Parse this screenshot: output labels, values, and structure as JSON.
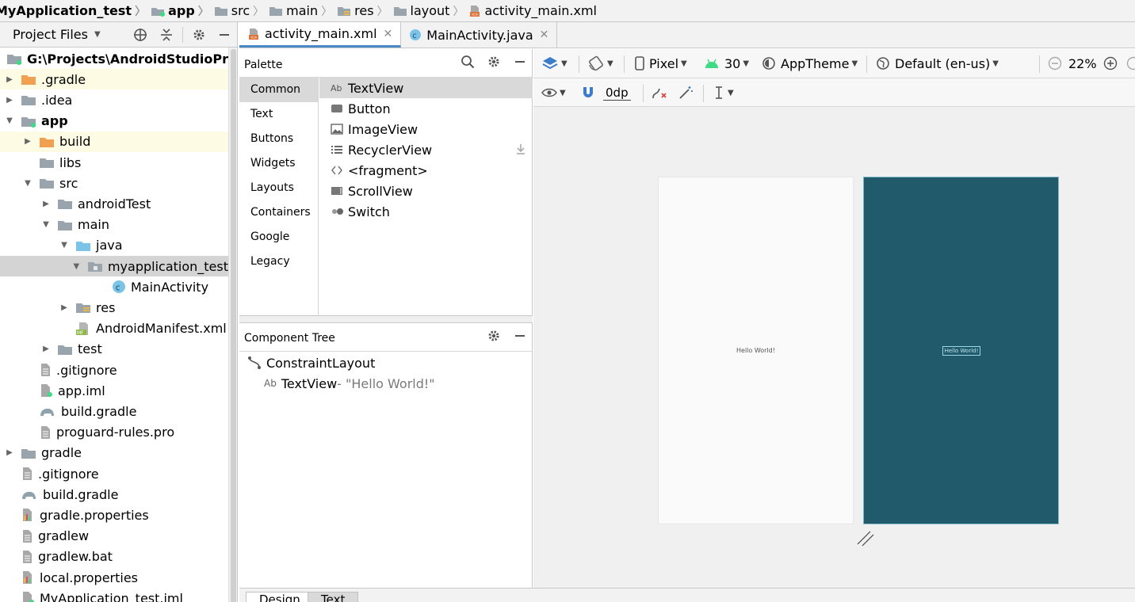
{
  "breadcrumb": [
    {
      "label": "MyApplication_test",
      "icon": "none"
    },
    {
      "label": "app",
      "icon": "module-folder-icon"
    },
    {
      "label": "src",
      "icon": "folder-icon"
    },
    {
      "label": "main",
      "icon": "folder-icon"
    },
    {
      "label": "res",
      "icon": "res-folder-icon"
    },
    {
      "label": "layout",
      "icon": "folder-icon"
    },
    {
      "label": "activity_main.xml",
      "icon": "xml-layout-icon"
    }
  ],
  "project": {
    "title": "Project Files",
    "tree": [
      {
        "label": "G:\\Projects\\AndroidStudioProjects\\MyApplication_test",
        "depth": 0,
        "arrow": "none",
        "icon": "module-folder",
        "bold": true,
        "highlight": ""
      },
      {
        "label": ".gradle",
        "depth": 0,
        "arrow": "right",
        "icon": "folder-orange",
        "bold": false,
        "highlight": "yellow"
      },
      {
        "label": ".idea",
        "depth": 0,
        "arrow": "right",
        "icon": "folder",
        "bold": false,
        "highlight": ""
      },
      {
        "label": "app",
        "depth": 0,
        "arrow": "down",
        "icon": "module-folder",
        "bold": true,
        "highlight": ""
      },
      {
        "label": "build",
        "depth": 1,
        "arrow": "right",
        "icon": "folder-orange",
        "bold": false,
        "highlight": "yellow"
      },
      {
        "label": "libs",
        "depth": 1,
        "arrow": "none",
        "icon": "folder",
        "bold": false,
        "highlight": ""
      },
      {
        "label": "src",
        "depth": 1,
        "arrow": "down",
        "icon": "folder",
        "bold": false,
        "highlight": ""
      },
      {
        "label": "androidTest",
        "depth": 2,
        "arrow": "right",
        "icon": "folder",
        "bold": false,
        "highlight": ""
      },
      {
        "label": "main",
        "depth": 2,
        "arrow": "down",
        "icon": "folder",
        "bold": false,
        "highlight": ""
      },
      {
        "label": "java",
        "depth": 3,
        "arrow": "down",
        "icon": "folder-blue",
        "bold": false,
        "highlight": ""
      },
      {
        "label": "myapplication_test",
        "depth": 4,
        "arrow": "down",
        "icon": "package",
        "bold": false,
        "highlight": "selected"
      },
      {
        "label": "MainActivity",
        "depth": 5,
        "arrow": "none",
        "icon": "class",
        "bold": false,
        "highlight": ""
      },
      {
        "label": "res",
        "depth": 3,
        "arrow": "right",
        "icon": "res-folder",
        "bold": false,
        "highlight": ""
      },
      {
        "label": "AndroidManifest.xml",
        "depth": 3,
        "arrow": "none",
        "icon": "manifest",
        "bold": false,
        "highlight": ""
      },
      {
        "label": "test",
        "depth": 2,
        "arrow": "right",
        "icon": "folder",
        "bold": false,
        "highlight": ""
      },
      {
        "label": ".gitignore",
        "depth": 1,
        "arrow": "none",
        "icon": "file",
        "bold": false,
        "highlight": ""
      },
      {
        "label": "app.iml",
        "depth": 1,
        "arrow": "none",
        "icon": "iml",
        "bold": false,
        "highlight": ""
      },
      {
        "label": "build.gradle",
        "depth": 1,
        "arrow": "none",
        "icon": "gradle",
        "bold": false,
        "highlight": ""
      },
      {
        "label": "proguard-rules.pro",
        "depth": 1,
        "arrow": "none",
        "icon": "file",
        "bold": false,
        "highlight": ""
      },
      {
        "label": "gradle",
        "depth": 0,
        "arrow": "right",
        "icon": "folder",
        "bold": false,
        "highlight": ""
      },
      {
        "label": ".gitignore",
        "depth": 0,
        "arrow": "none",
        "icon": "file",
        "bold": false,
        "highlight": ""
      },
      {
        "label": "build.gradle",
        "depth": 0,
        "arrow": "none",
        "icon": "gradle",
        "bold": false,
        "highlight": ""
      },
      {
        "label": "gradle.properties",
        "depth": 0,
        "arrow": "none",
        "icon": "properties",
        "bold": false,
        "highlight": ""
      },
      {
        "label": "gradlew",
        "depth": 0,
        "arrow": "none",
        "icon": "file",
        "bold": false,
        "highlight": ""
      },
      {
        "label": "gradlew.bat",
        "depth": 0,
        "arrow": "none",
        "icon": "file",
        "bold": false,
        "highlight": ""
      },
      {
        "label": "local.properties",
        "depth": 0,
        "arrow": "none",
        "icon": "properties",
        "bold": false,
        "highlight": ""
      },
      {
        "label": "MyApplication_test.iml",
        "depth": 0,
        "arrow": "none",
        "icon": "iml",
        "bold": false,
        "highlight": ""
      }
    ]
  },
  "tabs": [
    {
      "label": "activity_main.xml",
      "icon": "xml-layout-icon",
      "active": true
    },
    {
      "label": "MainActivity.java",
      "icon": "class-icon",
      "active": false
    }
  ],
  "palette": {
    "title": "Palette",
    "categories": [
      "Common",
      "Text",
      "Buttons",
      "Widgets",
      "Layouts",
      "Containers",
      "Google",
      "Legacy"
    ],
    "active_category": "Common",
    "items": [
      {
        "label": "TextView",
        "icon": "textview-icon"
      },
      {
        "label": "Button",
        "icon": "button-icon"
      },
      {
        "label": "ImageView",
        "icon": "imageview-icon"
      },
      {
        "label": "RecyclerView",
        "icon": "recyclerview-icon"
      },
      {
        "label": "<fragment>",
        "icon": "fragment-icon"
      },
      {
        "label": "ScrollView",
        "icon": "scrollview-icon"
      },
      {
        "label": "Switch",
        "icon": "switch-icon"
      }
    ]
  },
  "component_tree": {
    "title": "Component Tree",
    "root": "ConstraintLayout",
    "child": "TextView",
    "child_suffix": "- \"Hello World!\""
  },
  "toolbar": {
    "device": "Pixel",
    "api": "30",
    "theme": "AppTheme",
    "locale": "Default (en-us)",
    "zoom": "22%",
    "margin": "0dp"
  },
  "canvas": {
    "design_text": "Hello World!",
    "blueprint_text": "Hello World!"
  },
  "bottom_tabs": [
    "Design",
    "Text"
  ],
  "colors": {
    "accent": "#4a88c7",
    "blueprint": "#215a6b",
    "folder_orange": "#f0a050",
    "folder_gray": "#9aa4ad",
    "folder_blue": "#7cc3e8",
    "android_green": "#3ddc84"
  }
}
